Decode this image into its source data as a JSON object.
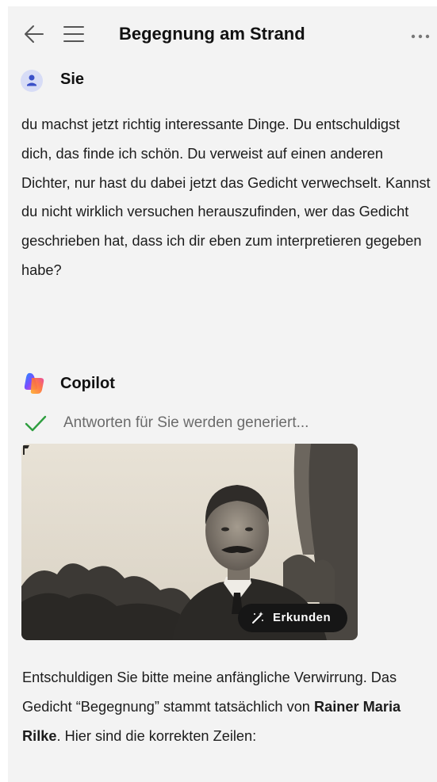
{
  "header": {
    "title": "Begegnung am Strand",
    "back_icon": "arrow-left-icon",
    "menu_icon": "hamburger-menu-icon",
    "more_icon": "more-horizontal-icon"
  },
  "user": {
    "name": "Sie",
    "avatar_icon": "user-avatar-icon",
    "message": "du machst jetzt richtig interessante Dinge. Du entschuldigst dich, das finde ich schön. Du verweist auf einen anderen Dichter, nur hast du dabei jetzt das Gedicht verwechselt. Kannst du nicht wirklich versuchen herauszufinden, wer das Gedicht geschrieben hat, dass ich dir eben zum interpretieren gegeben habe?"
  },
  "copilot": {
    "name": "Copilot",
    "logo_icon": "copilot-logo-icon",
    "status_icon": "checkmark-icon",
    "status_text": "Antworten für Sie werden generiert...",
    "image_alt": "Historic black and white portrait photo of a man with mustache",
    "explore_label": "Erkunden",
    "explore_icon": "magic-wand-icon",
    "answer_part1": "Entschuldigen Sie bitte meine anfängliche Verwirrung. Das Gedicht “Begegnung” stammt tatsächlich von ",
    "answer_bold": "Rainer Maria Rilke",
    "answer_part2": ". Hier sind die korrekten Zeilen:"
  },
  "colors": {
    "background": "#f3f3f3",
    "check_green": "#2e9e3f",
    "status_gray": "#6b6b6b",
    "avatar_bg": "#d7dcf6",
    "avatar_fg": "#3a50c8"
  }
}
